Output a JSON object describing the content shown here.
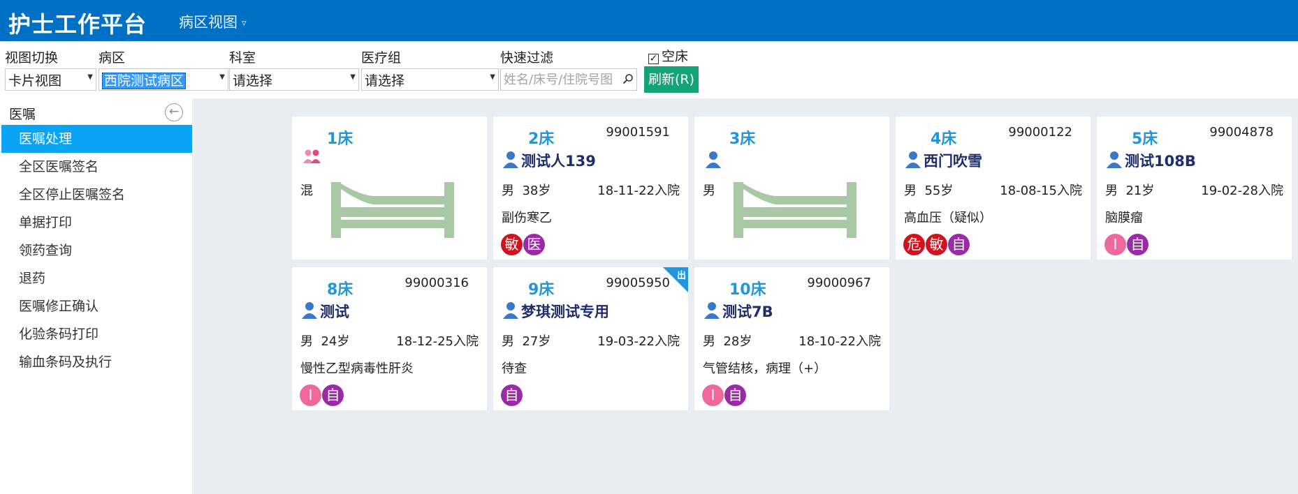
{
  "header": {
    "title": "护士工作平台",
    "view_menu": "病区视图",
    "view_menu_arrow": "▿"
  },
  "filters": {
    "view_switch": {
      "label": "视图切换",
      "value": "卡片视图"
    },
    "ward": {
      "label": "病区",
      "value": "西院测试病区"
    },
    "dept": {
      "label": "科室",
      "value": "请选择"
    },
    "med_group": {
      "label": "医疗组",
      "value": "请选择"
    },
    "quick_filter": {
      "label": "快速过滤",
      "placeholder": "姓名/床号/住院号图"
    },
    "empty_bed": {
      "label": "空床",
      "checked": true
    },
    "refresh_label": "刷新(R)"
  },
  "sidebar": {
    "title": "医嘱",
    "back_glyph": "←",
    "items": [
      {
        "label": "医嘱处理",
        "active": true
      },
      {
        "label": "全区医嘱签名"
      },
      {
        "label": "全区停止医嘱签名"
      },
      {
        "label": "单据打印"
      },
      {
        "label": "领药查询"
      },
      {
        "label": "退药"
      },
      {
        "label": "医嘱修正确认"
      },
      {
        "label": "化验条码打印"
      },
      {
        "label": "输血条码及执行"
      }
    ]
  },
  "colors": {
    "header_bg": "#0070c4",
    "sidebar_active": "#0aa4f5",
    "refresh_bg": "#15a479",
    "bed_no": "#2196e0",
    "patient_name": "#1e2d6b",
    "badge_red": "#d4101b",
    "badge_purple": "#9c2aa8",
    "badge_pink": "#f0679c",
    "empty_bed_icon": "#a9c9a6",
    "main_bg": "#e9edf2"
  },
  "cards": [
    {
      "bed": "1床",
      "empty": true,
      "gender_icon": "female-pair-icon",
      "gender": "混"
    },
    {
      "bed": "2床",
      "inpatient_no": "99001591",
      "name": "测试人139",
      "gender": "男",
      "age": "38岁",
      "admission": "18-11-22入院",
      "diagnosis": "副伤寒乙",
      "badges": [
        "敏",
        "医"
      ]
    },
    {
      "bed": "3床",
      "empty": true,
      "gender_icon": "person-icon",
      "gender": "男"
    },
    {
      "bed": "4床",
      "inpatient_no": "99000122",
      "name": "西门吹雪",
      "gender": "男",
      "age": "55岁",
      "admission": "18-08-15入院",
      "diagnosis": "高血压（疑似）",
      "badges": [
        "危",
        "敏",
        "自"
      ]
    },
    {
      "bed": "5床",
      "inpatient_no": "99004878",
      "name": "测试108B",
      "gender": "男",
      "age": "21岁",
      "admission": "19-02-28入院",
      "diagnosis": "脑膜瘤",
      "badges": [
        "I",
        "自"
      ]
    },
    {
      "bed": "8床",
      "inpatient_no": "99000316",
      "name": "测试",
      "gender": "男",
      "age": "24岁",
      "admission": "18-12-25入院",
      "diagnosis": "慢性乙型病毒性肝炎",
      "badges": [
        "I",
        "自"
      ]
    },
    {
      "bed": "9床",
      "inpatient_no": "99005950",
      "name": "梦琪测试专用",
      "gender": "男",
      "age": "27岁",
      "admission": "19-03-22入院",
      "diagnosis": "待查",
      "badges": [
        "自"
      ],
      "corner_tag": "出"
    },
    {
      "bed": "10床",
      "inpatient_no": "99000967",
      "name": "测试7B",
      "gender": "男",
      "age": "28岁",
      "admission": "18-10-22入院",
      "diagnosis": "气管结核，病理（+）",
      "badges": [
        "I",
        "自"
      ]
    }
  ]
}
